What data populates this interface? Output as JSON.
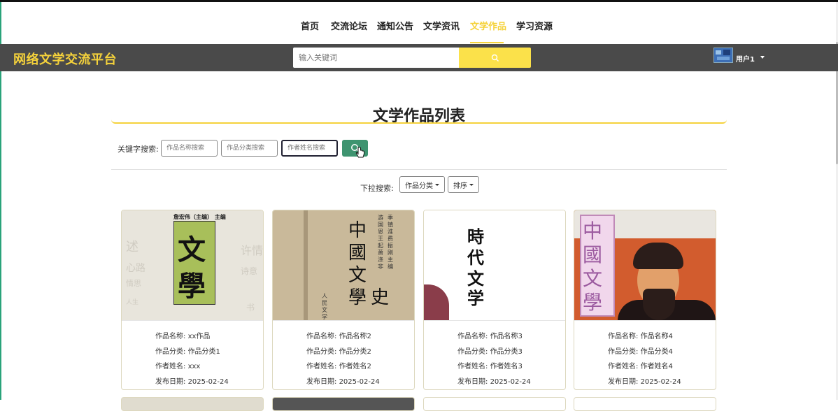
{
  "nav": {
    "items": [
      {
        "label": "首页",
        "active": false
      },
      {
        "label": "交流论坛",
        "active": false
      },
      {
        "label": "通知公告",
        "active": false
      },
      {
        "label": "文学资讯",
        "active": false
      },
      {
        "label": "文学作品",
        "active": true
      },
      {
        "label": "学习资源",
        "active": false
      }
    ]
  },
  "header": {
    "brand": "网络文学交流平台",
    "search_placeholder": "输入关键词",
    "search_icon": "search-icon",
    "user": "用户1"
  },
  "page": {
    "title": "文学作品列表"
  },
  "filters": {
    "keyword_label": "关键字搜索:",
    "name_placeholder": "作品名称搜索",
    "category_placeholder": "作品分类搜索",
    "author_placeholder": "作者姓名搜索",
    "dropdown_label": "下拉搜索:",
    "category_dropdown": "作品分类",
    "sort_dropdown": "排序"
  },
  "works": [
    {
      "name_label": "作品名称:",
      "name": "xx作品",
      "category_label": "作品分类:",
      "category": "作品分类1",
      "author_label": "作者姓名:",
      "author": "xxx",
      "date_label": "发布日期:",
      "date": "2025-02-24",
      "cover_title": "文學",
      "cover_top": "詹宏伟（主编） 主编"
    },
    {
      "name_label": "作品名称:",
      "name": "作品名称2",
      "category_label": "作品分类:",
      "category": "作品分类2",
      "author_label": "作者姓名:",
      "author": "作者姓名2",
      "date_label": "发布日期:",
      "date": "2025-02-24",
      "cover_title": "中国文学史",
      "cover_side": "人民文学出版社"
    },
    {
      "name_label": "作品名称:",
      "name": "作品名称3",
      "category_label": "作品分类:",
      "category": "作品分类3",
      "author_label": "作者姓名:",
      "author": "作者姓名3",
      "date_label": "发布日期:",
      "date": "2025-02-24",
      "cover_title": "時代文学"
    },
    {
      "name_label": "作品名称:",
      "name": "作品名称4",
      "category_label": "作品分类:",
      "category": "作品分类4",
      "author_label": "作者姓名:",
      "author": "作者姓名4",
      "date_label": "发布日期:",
      "date": "2025-02-24",
      "cover_title": "中國文學"
    }
  ],
  "colors": {
    "accent": "#f5d23b",
    "header_bg": "#4a4a4a",
    "search_button": "#fbe14a",
    "filter_search_button": "#3e9470"
  }
}
